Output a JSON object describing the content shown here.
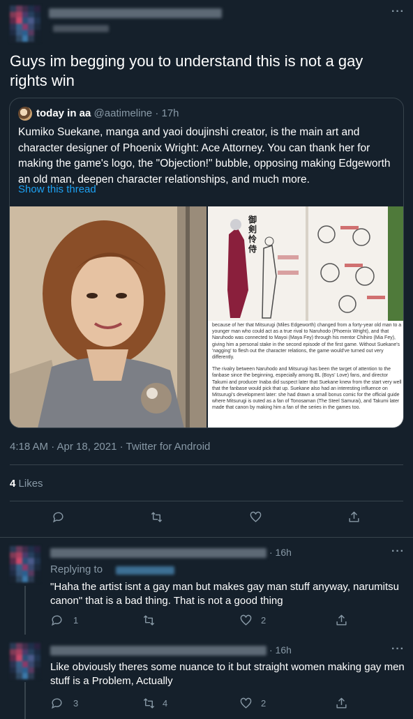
{
  "main_tweet": {
    "text": "Guys im begging you to understand this is not a gay rights win",
    "timestamp": "4:18 AM · Apr 18, 2021 · Twitter for Android",
    "likes_count": "4",
    "likes_label": "Likes",
    "more_glyph": "···"
  },
  "quote": {
    "display_name": "today in aa",
    "handle": "@aatimeline",
    "separator": "·",
    "age": "17h",
    "body": "Kumiko Suekane, manga and yaoi doujinshi creator, is the main art and character designer of Phoenix Wright: Ace Attorney. You can thank her for making the game's logo, the \"Objection!\" bubble, opposing making Edgeworth an old man, deepen character relationships, and much more.",
    "show_thread": "Show this thread",
    "book_text_p1": "because of her that Mitsurugi (Miles Edgeworth) changed from a forty-year old man to a younger man who could act as a true rival to Naruhodo (Phoenix Wright), and that Naruhodo was connected to Mayoi (Maya Fey) through his mentor Chihiro (Mia Fey), giving him a personal stake in the second episode of the first game. Without Suekane's 'nagging' to flesh out the character relations, the game would've turned out very differently.",
    "book_text_p2": "The rivalry between Naruhodo and Mitsurugi has been the target of attention to the fanbase since the beginning, especially among BL (Boys' Love) fans, and director Takumi and producer Inaba did suspect later that Suekane knew from the start very well that the fanbase would pick that up. Suekane also had an interesting influence on Mitsurugi's development later: she had drawn a small bonus comic for the official guide where Mitsurugi is outed as a fan of Tonosaman (The Steel Samurai), and Takumi later made that canon by making him a fan of the series in the games too.",
    "book_vertical_title": "御剣怜侍"
  },
  "replies": [
    {
      "age": "· 16h",
      "replying_to_label": "Replying to",
      "text": "\"Haha the artist isnt a gay man but makes gay man stuff anyway, narumitsu canon\" that is a bad thing. That is not a good thing",
      "reply_count": "1",
      "retweet_count": "",
      "like_count": "2"
    },
    {
      "age": "· 16h",
      "text": "Like obviously theres some nuance to it but straight women making gay men stuff is a Problem, Actually",
      "reply_count": "3",
      "retweet_count": "4",
      "like_count": "2"
    }
  ],
  "colors": {
    "background": "#15202b",
    "muted": "#8899a6",
    "link": "#1da1f2",
    "border": "#38444d"
  }
}
